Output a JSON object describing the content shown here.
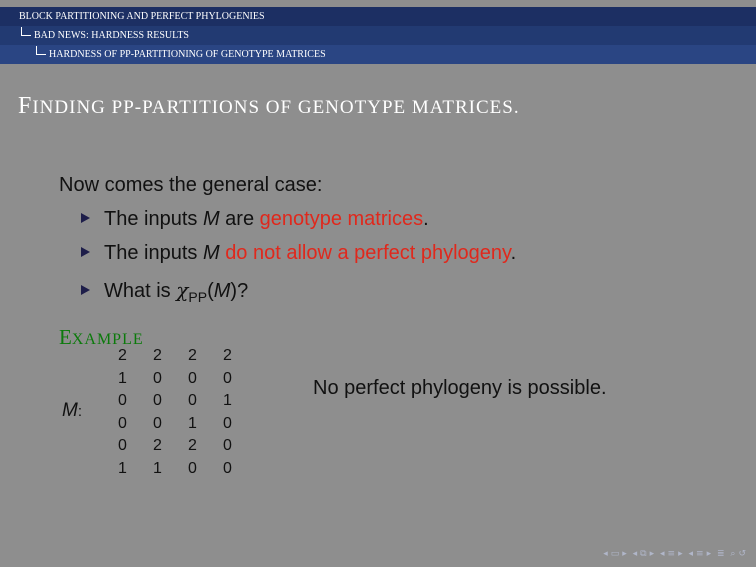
{
  "headlines": {
    "section": {
      "first": "B",
      "rest": "LOCK ",
      "first2": "P",
      "rest2": "ARTITIONING AND ",
      "first3": "P",
      "rest3": "ERFECT ",
      "first4": "P",
      "rest4": "HYLOGENIES"
    },
    "subsection": {
      "first": "B",
      "rest": "AD ",
      "first2": "N",
      "rest2": "EWS: ",
      "first3": "H",
      "rest3": "ARDNESS ",
      "first4": "R",
      "rest4": "ESULTS"
    },
    "subsubsection": {
      "first": "H",
      "rest": "ARDNESS OF ",
      "first2": "PP-P",
      "rest2": "ARTITIONING OF ",
      "first3": "G",
      "rest3": "ENOTYPE ",
      "first4": "M",
      "rest4": "ATRICES"
    }
  },
  "frame": {
    "title_first": "F",
    "title_rest": "INDING PP-PARTITIONS OF GENOTYPE MATRICES."
  },
  "body": {
    "intro": "Now comes the general case:",
    "bullets": [
      {
        "pre": "The inputs ",
        "var": "M",
        "mid": " are ",
        "highlight": "genotype matrices",
        "post": "."
      },
      {
        "pre": "The inputs ",
        "var": "M",
        "mid": " ",
        "highlight": "do not allow a perfect phylogeny",
        "post": "."
      },
      {
        "pre": "What is ",
        "chi": "χ",
        "sub": "PP",
        "paren_open": "(",
        "var": "M",
        "paren_close": ")?"
      }
    ]
  },
  "example": {
    "label_first": "E",
    "label_rest": "XAMPLE",
    "matrix_label": "M",
    "matrix_colon": ":",
    "rows": [
      [
        "2",
        "2",
        "2",
        "2"
      ],
      [
        "1",
        "0",
        "0",
        "0"
      ],
      [
        "0",
        "0",
        "0",
        "1"
      ],
      [
        "0",
        "0",
        "1",
        "0"
      ],
      [
        "0",
        "2",
        "2",
        "0"
      ],
      [
        "1",
        "1",
        "0",
        "0"
      ]
    ],
    "note": "No perfect phylogeny is possible."
  },
  "navigation": {
    "icons": [
      "nav-left-icon",
      "frame-icon",
      "nav-right-icon",
      "nav-left-icon",
      "slide-icon",
      "nav-right-icon",
      "nav-left-icon",
      "subsection-icon",
      "nav-right-icon",
      "nav-left-icon",
      "section-icon",
      "nav-right-icon",
      "align-icon",
      "search-icon",
      "back-icon"
    ]
  }
}
